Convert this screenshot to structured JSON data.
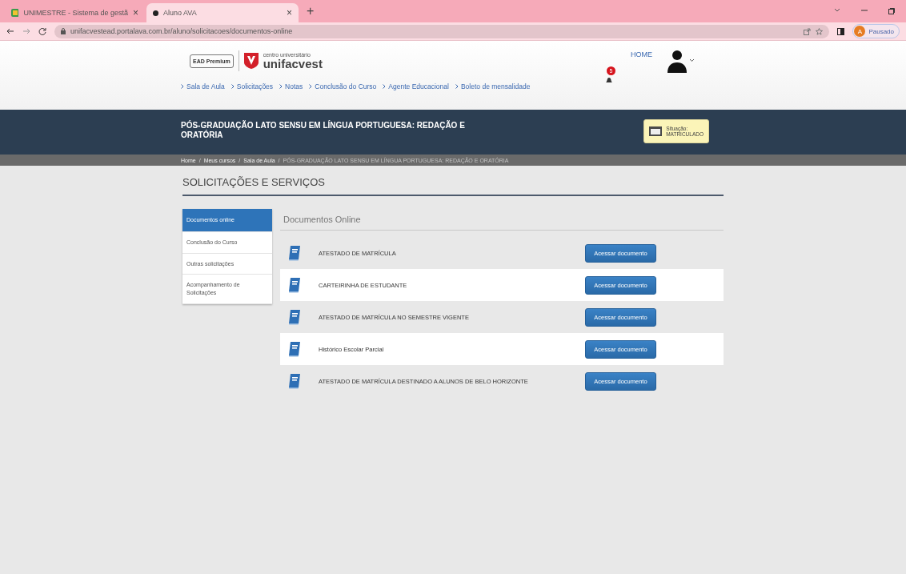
{
  "browser": {
    "tabs": [
      {
        "title": "UNIMESTRE - Sistema de gestã",
        "selected": false,
        "close": "×"
      },
      {
        "title": "Aluno AVA",
        "selected": true,
        "close": "×"
      }
    ],
    "new_tab": "+",
    "url": "unifacvestead.portalava.com.br/aluno/solicitacoes/documentos-online",
    "profile": "Pausado",
    "profile_initial": "A"
  },
  "header": {
    "brand_badge": "EAD Premium",
    "brand_caption": "centro universitário",
    "brand_name": "unifacvest",
    "home": "HOME",
    "notification_count": "5",
    "nav": [
      {
        "label": "Sala de Aula"
      },
      {
        "label": "Solicitações"
      },
      {
        "label": "Notas"
      },
      {
        "label": "Conclusão do Curso"
      },
      {
        "label": "Agente Educacional"
      },
      {
        "label": "Boleto de mensalidade"
      }
    ]
  },
  "course": {
    "title": "PÓS-GRADUAÇÃO LATO SENSU EM LÍNGUA PORTUGUESA: REDAÇÃO E ORATÓRIA",
    "status_label": "Situação:",
    "status_value": "MATRICULADO"
  },
  "breadcrumb": [
    {
      "label": "Home",
      "current": false
    },
    {
      "label": "Meus cursos",
      "current": false
    },
    {
      "label": "Sala de Aula",
      "current": false
    },
    {
      "label": "PÓS-GRADUAÇÃO LATO SENSU EM LÍNGUA PORTUGUESA: REDAÇÃO E ORATÓRIA",
      "current": true
    }
  ],
  "breadcrumb_separator": "/",
  "page_title": "SOLICITAÇÕES E SERVIÇOS",
  "sidebar": {
    "items": [
      {
        "label": "Documentos online",
        "selected": true
      },
      {
        "label": "Conclusão do Curso",
        "selected": false
      },
      {
        "label": "Outras solicitações",
        "selected": false
      },
      {
        "label": "Acompanhamento de Solicitações",
        "selected": false
      }
    ]
  },
  "section_title": "Documentos Online",
  "documents": [
    {
      "name": "ATESTADO DE MATRÍCULA",
      "button": "Acessar documento"
    },
    {
      "name": "CARTEIRINHA DE ESTUDANTE",
      "button": "Acessar documento"
    },
    {
      "name": "ATESTADO DE MATRÍCULA NO SEMESTRE VIGENTE",
      "button": "Acessar documento"
    },
    {
      "name": "Histórico Escolar Parcial",
      "button": "Acessar documento"
    },
    {
      "name": "ATESTADO DE MATRÍCULA DESTINADO A ALUNOS DE BELO HORIZONTE",
      "button": "Acessar documento"
    }
  ]
}
